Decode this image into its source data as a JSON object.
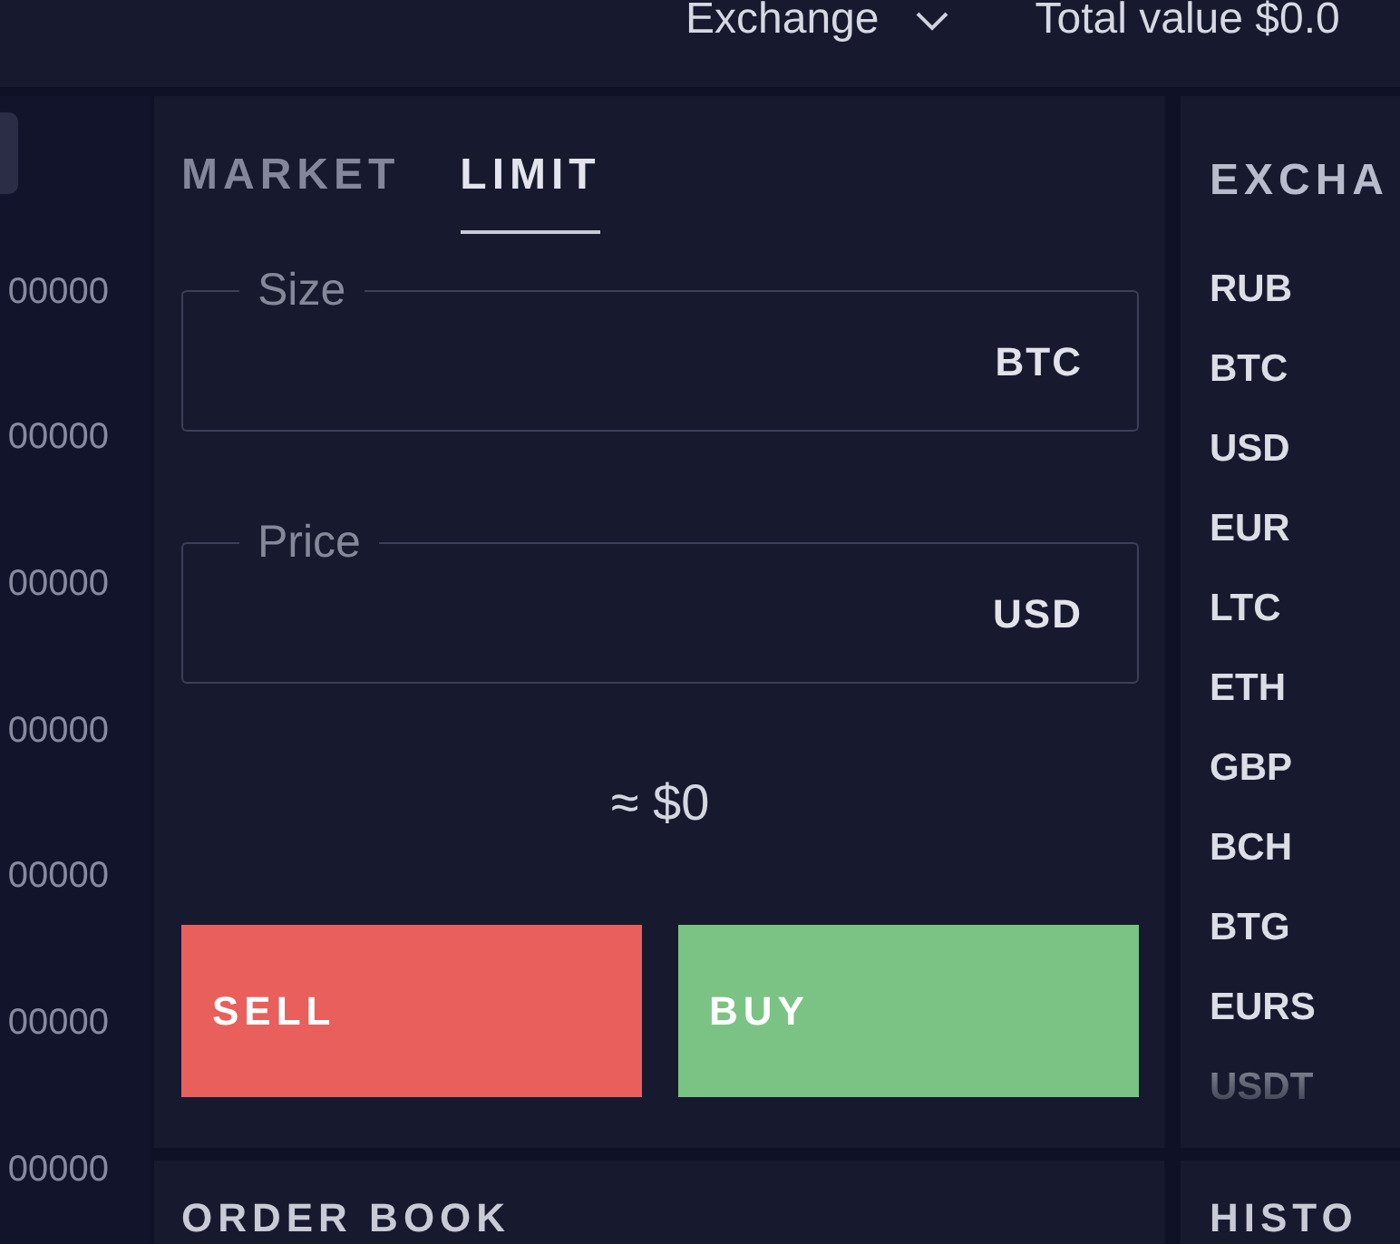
{
  "top_bar": {
    "menu": {
      "label": "Exchange"
    },
    "total_value": "Total value $0.0"
  },
  "left_column": {
    "values": [
      "00000",
      "00000",
      "00000",
      "00000",
      "00000",
      "00000",
      "00000"
    ]
  },
  "order_form": {
    "tabs": [
      {
        "label": "MARKET",
        "selected": false
      },
      {
        "label": "LIMIT",
        "selected": true
      }
    ],
    "fields": [
      {
        "label": "Size",
        "unit": "BTC"
      },
      {
        "label": "Price",
        "unit": "USD"
      }
    ],
    "estimate": "≈ $0",
    "buttons": [
      {
        "label": "SELL",
        "kind": "sell"
      },
      {
        "label": "BUY",
        "kind": "buy"
      }
    ]
  },
  "exchange_panel": {
    "title": "EXCHA",
    "currencies": [
      "RUB",
      "BTC",
      "USD",
      "EUR",
      "LTC",
      "ETH",
      "GBP",
      "BCH",
      "BTG",
      "EURS",
      "USDT"
    ]
  },
  "bottom_panels": [
    {
      "title": "ORDER BOOK"
    },
    {
      "title": "HISTO"
    }
  ]
}
